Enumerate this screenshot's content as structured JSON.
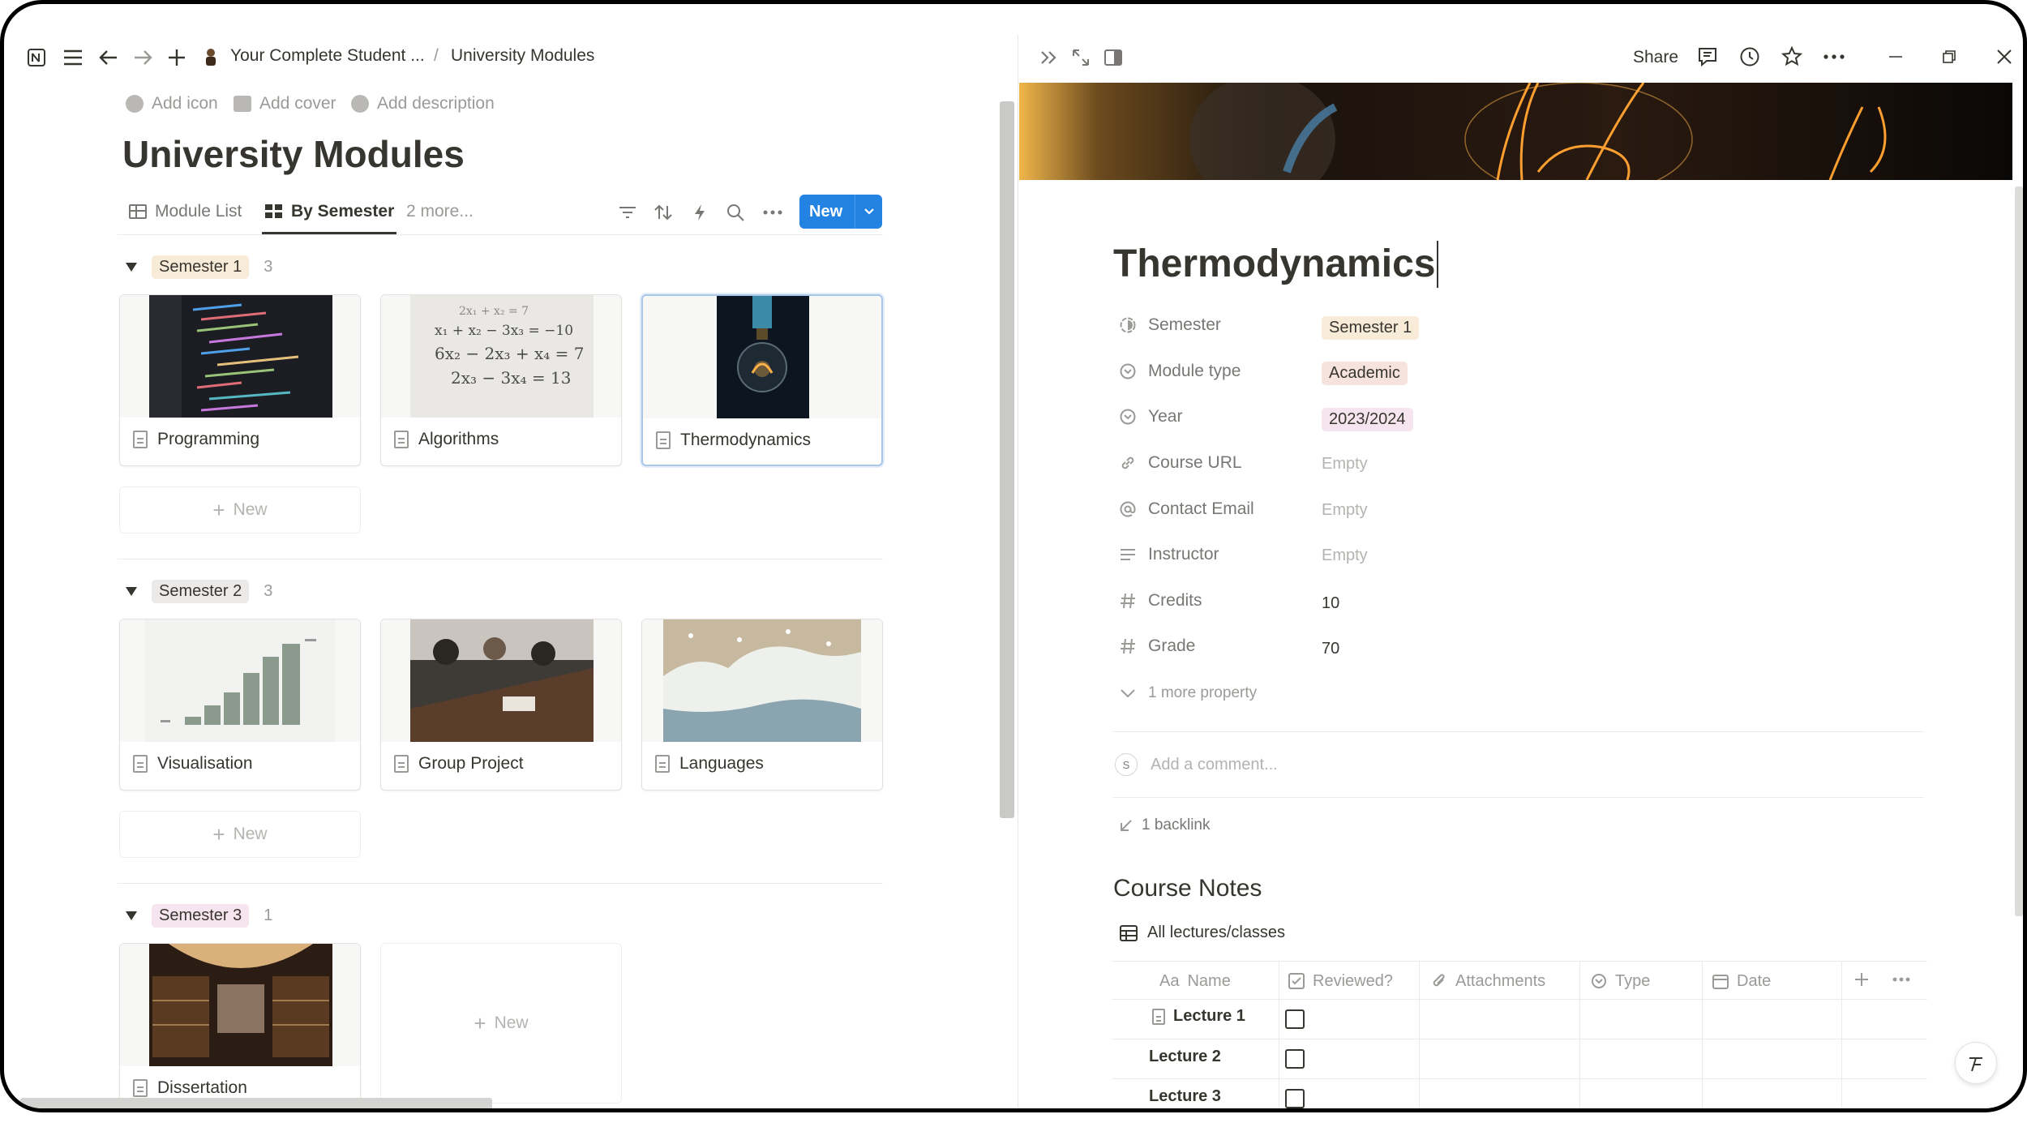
{
  "topbar": {
    "breadcrumb_parent": "Your Complete Student ...",
    "breadcrumb_sep": "/",
    "breadcrumb_current": "University Modules"
  },
  "page_options": {
    "add_icon": "Add icon",
    "add_cover": "Add cover",
    "add_description": "Add description"
  },
  "database": {
    "title": "University Modules",
    "views": [
      {
        "label": "Module List"
      },
      {
        "label": "By Semester"
      },
      {
        "label": "2 more..."
      }
    ],
    "new_label": "New",
    "new_card_label": "New",
    "groups": [
      {
        "name": "Semester 1",
        "count": "3",
        "color": "#f8ecd9",
        "cards": [
          {
            "title": "Programming"
          },
          {
            "title": "Algorithms"
          },
          {
            "title": "Thermodynamics"
          }
        ]
      },
      {
        "name": "Semester 2",
        "count": "3",
        "color": "#ebeae8",
        "cards": [
          {
            "title": "Visualisation"
          },
          {
            "title": "Group Project"
          },
          {
            "title": "Languages"
          }
        ]
      },
      {
        "name": "Semester 3",
        "count": "1",
        "color": "#f6e5ee",
        "cards": [
          {
            "title": "Dissertation"
          }
        ]
      }
    ]
  },
  "algorithms_cover_text": [
    "2x₁ + x₂ = 7",
    "x₁ + x₂ − 3x₃ = −10",
    "6x₂ − 2x₃ + x₄ = 7",
    "2x₃ − 3x₄ = 13"
  ],
  "peek": {
    "share": "Share",
    "page_title": "Thermodynamics",
    "properties": [
      {
        "name": "Semester",
        "icon": "status-icon",
        "value": "Semester 1",
        "tag_color": "#f8ecd9"
      },
      {
        "name": "Module type",
        "icon": "select-icon",
        "value": "Academic",
        "tag_color": "#f6e3dd"
      },
      {
        "name": "Year",
        "icon": "select-icon",
        "value": "2023/2024",
        "tag_color": "#f6e5ee"
      },
      {
        "name": "Course URL",
        "icon": "link-icon",
        "value": "Empty"
      },
      {
        "name": "Contact Email",
        "icon": "at-icon",
        "value": "Empty"
      },
      {
        "name": "Instructor",
        "icon": "text-icon",
        "value": "Empty"
      },
      {
        "name": "Credits",
        "icon": "hash-icon",
        "value": "10"
      },
      {
        "name": "Grade",
        "icon": "hash-icon",
        "value": "70"
      }
    ],
    "more_property": "1 more property",
    "comment_avatar": "S",
    "comment_placeholder": "Add a comment...",
    "backlinks": "1 backlink",
    "section_heading": "Course Notes",
    "inline_db_title": "All lectures/classes",
    "columns": [
      "Name",
      "Reviewed?",
      "Attachments",
      "Type",
      "Date"
    ],
    "name_col_prefix": "Aa",
    "rows": [
      "Lecture 1",
      "Lecture 2",
      "Lecture 3"
    ]
  },
  "colors": {
    "accent": "#2383e2",
    "text": "#37352f",
    "muted": "#9b9a97"
  }
}
